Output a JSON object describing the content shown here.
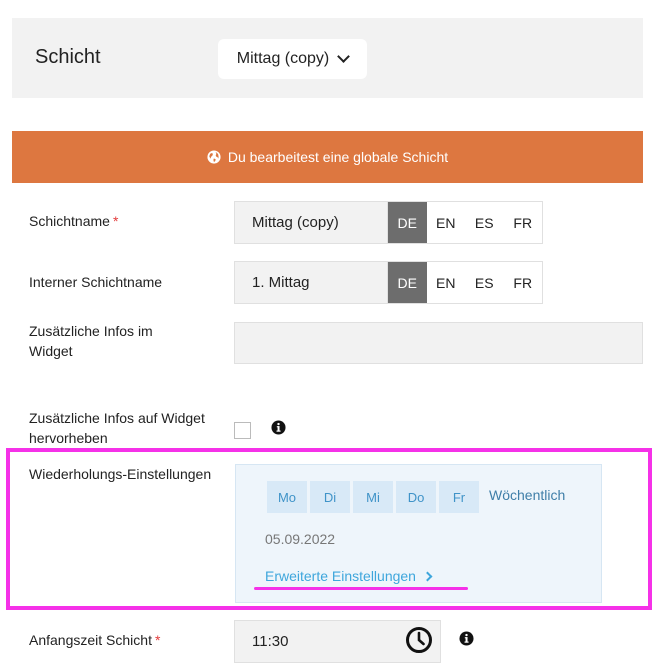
{
  "shift": {
    "label": "Schicht",
    "selected": "Mittag (copy)"
  },
  "banner": {
    "text": "Du bearbeitest eine globale Schicht",
    "color": "#dd7740"
  },
  "fields": {
    "name": {
      "label": "Schichtname",
      "required_mark": "*",
      "value": "Mittag (copy)"
    },
    "internal_name": {
      "label": "Interner Schichtname",
      "value": "1. Mittag"
    },
    "widget_info": {
      "label": "Zusätzliche Infos im Widget"
    },
    "highlight_widget": {
      "label": "Zusätzliche Infos auf Widget hervorheben"
    },
    "repeat": {
      "label": "Wiederholungs-Einstellungen",
      "days": [
        "Mo",
        "Di",
        "Mi",
        "Do",
        "Fr"
      ],
      "frequency": "Wöchentlich",
      "date": "05.09.2022",
      "advanced_link": "Erweiterte Einstellungen"
    },
    "start_time": {
      "label": "Anfangszeit Schicht",
      "required_mark": "*",
      "value": "11:30"
    }
  },
  "languages": [
    "DE",
    "EN",
    "ES",
    "FR"
  ],
  "colors": {
    "highlight": "#f531e8",
    "accent_blue": "#3ea6dc",
    "active_lang": "#6d6d6d"
  }
}
